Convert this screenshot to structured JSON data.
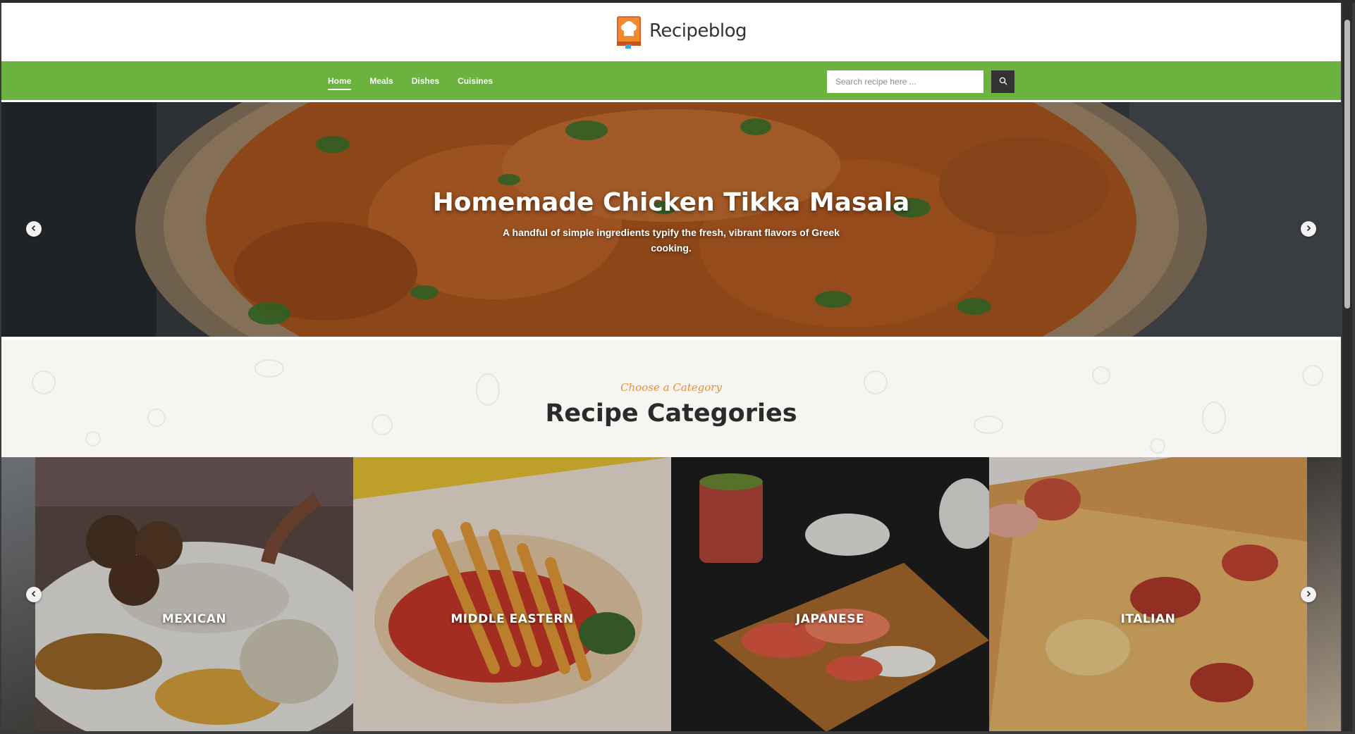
{
  "brand": {
    "logo_text_a": "Recipe",
    "logo_text_b": "blog",
    "logo_icon": "chef-book-icon"
  },
  "nav": {
    "items": [
      {
        "label": "Home",
        "active": true
      },
      {
        "label": "Meals",
        "active": false
      },
      {
        "label": "Dishes",
        "active": false
      },
      {
        "label": "Cuisines",
        "active": false
      }
    ],
    "search_placeholder": "Search recipe here ...",
    "search_icon": "search-icon"
  },
  "hero": {
    "title": "Homemade Chicken Tikka Masala",
    "subtitle": "A handful of simple ingredients typify the fresh, vibrant flavors of Greek cooking.",
    "prev_icon": "chevron-left-icon",
    "next_icon": "chevron-right-icon"
  },
  "categories": {
    "eyebrow": "Choose a Category",
    "title": "Recipe Categories",
    "items": [
      {
        "label": "MEXICAN"
      },
      {
        "label": "MIDDLE EASTERN"
      },
      {
        "label": "JAPANESE"
      },
      {
        "label": "ITALIAN"
      }
    ]
  },
  "colors": {
    "nav_green": "#6bb33e",
    "eyebrow_orange": "#e7903a",
    "dark": "#333333"
  }
}
